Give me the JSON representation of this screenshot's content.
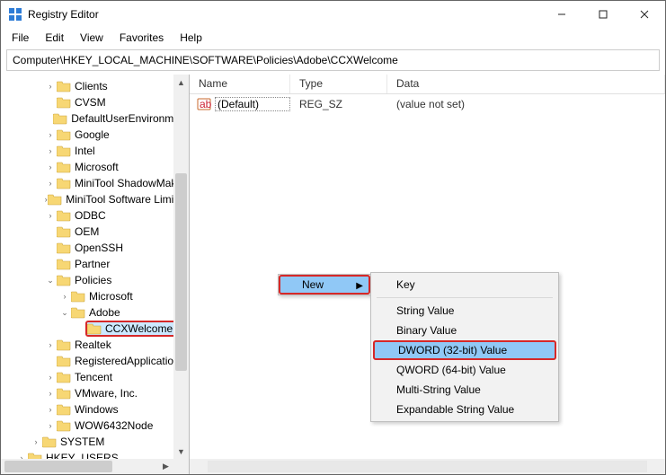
{
  "window": {
    "title": "Registry Editor"
  },
  "menubar": [
    "File",
    "Edit",
    "View",
    "Favorites",
    "Help"
  ],
  "address": "Computer\\HKEY_LOCAL_MACHINE\\SOFTWARE\\Policies\\Adobe\\CCXWelcome",
  "tree": {
    "items": [
      {
        "depth": 3,
        "exp": "closed",
        "label": "Clients"
      },
      {
        "depth": 3,
        "exp": "none",
        "label": "CVSM"
      },
      {
        "depth": 3,
        "exp": "none",
        "label": "DefaultUserEnvironment"
      },
      {
        "depth": 3,
        "exp": "closed",
        "label": "Google"
      },
      {
        "depth": 3,
        "exp": "closed",
        "label": "Intel"
      },
      {
        "depth": 3,
        "exp": "closed",
        "label": "Microsoft"
      },
      {
        "depth": 3,
        "exp": "closed",
        "label": "MiniTool ShadowMaker"
      },
      {
        "depth": 3,
        "exp": "closed",
        "label": "MiniTool Software Limited"
      },
      {
        "depth": 3,
        "exp": "closed",
        "label": "ODBC"
      },
      {
        "depth": 3,
        "exp": "none",
        "label": "OEM"
      },
      {
        "depth": 3,
        "exp": "none",
        "label": "OpenSSH"
      },
      {
        "depth": 3,
        "exp": "none",
        "label": "Partner"
      },
      {
        "depth": 3,
        "exp": "open",
        "label": "Policies"
      },
      {
        "depth": 4,
        "exp": "closed",
        "label": "Microsoft"
      },
      {
        "depth": 4,
        "exp": "open",
        "label": "Adobe"
      },
      {
        "depth": 5,
        "exp": "none",
        "label": "CCXWelcome",
        "highlight": true
      },
      {
        "depth": 3,
        "exp": "closed",
        "label": "Realtek"
      },
      {
        "depth": 3,
        "exp": "none",
        "label": "RegisteredApplications"
      },
      {
        "depth": 3,
        "exp": "closed",
        "label": "Tencent"
      },
      {
        "depth": 3,
        "exp": "closed",
        "label": "VMware, Inc."
      },
      {
        "depth": 3,
        "exp": "closed",
        "label": "Windows"
      },
      {
        "depth": 3,
        "exp": "closed",
        "label": "WOW6432Node"
      },
      {
        "depth": 2,
        "exp": "closed",
        "label": "SYSTEM"
      },
      {
        "depth": 1,
        "exp": "closed",
        "label": "HKEY_USERS"
      }
    ]
  },
  "list": {
    "cols": {
      "name": "Name",
      "type": "Type",
      "data": "Data"
    },
    "rows": [
      {
        "name": "(Default)",
        "type": "REG_SZ",
        "data": "(value not set)"
      }
    ]
  },
  "context": {
    "menu1": {
      "new": "New"
    },
    "submenu": {
      "key": "Key",
      "string": "String Value",
      "binary": "Binary Value",
      "dword": "DWORD (32-bit) Value",
      "qword": "QWORD (64-bit) Value",
      "multi": "Multi-String Value",
      "expand": "Expandable String Value"
    }
  }
}
